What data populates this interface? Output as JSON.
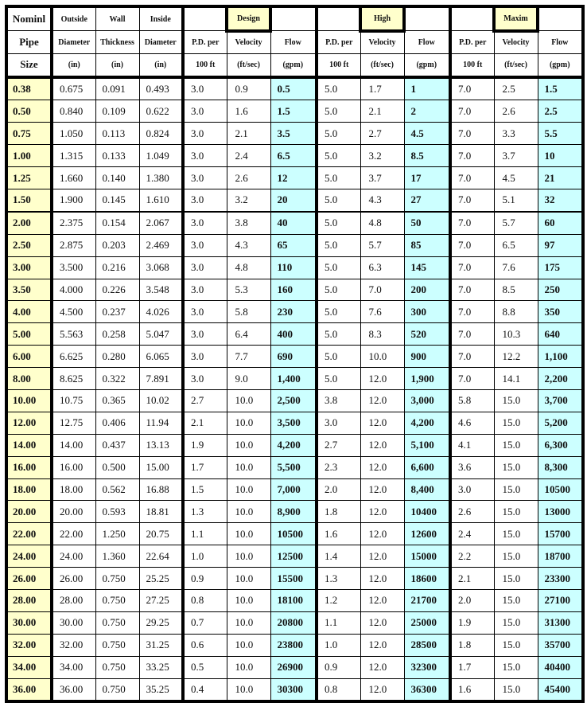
{
  "header": {
    "row1": [
      "Nominl",
      "Outside",
      "Wall",
      "Inside",
      "",
      "Design",
      "",
      "",
      "High",
      "",
      "",
      "Maxim",
      ""
    ],
    "row2": [
      "Pipe",
      "Diameter",
      "Thickness",
      "Diameter",
      "P.D. per",
      "Velocity",
      "Flow",
      "P.D. per",
      "Velocity",
      "Flow",
      "P.D. per",
      "Velocity",
      "Flow"
    ],
    "row3": [
      "Size",
      "(in)",
      "(in)",
      "(in)",
      "100 ft",
      "(ft/sec)",
      "(gpm)",
      "100 ft",
      "(ft/sec)",
      "(gpm)",
      "100 ft",
      "(ft/sec)",
      "(gpm)"
    ]
  },
  "colors": {
    "size_fill": "#ffffcc",
    "flow_fill": "#ccffff",
    "badge_fill": "#ffffcc"
  },
  "rows": [
    [
      "0.38",
      "0.675",
      "0.091",
      "0.493",
      "3.0",
      "0.9",
      "0.5",
      "5.0",
      "1.7",
      "1",
      "7.0",
      "2.5",
      "1.5"
    ],
    [
      "0.50",
      "0.840",
      "0.109",
      "0.622",
      "3.0",
      "1.6",
      "1.5",
      "5.0",
      "2.1",
      "2",
      "7.0",
      "2.6",
      "2.5"
    ],
    [
      "0.75",
      "1.050",
      "0.113",
      "0.824",
      "3.0",
      "2.1",
      "3.5",
      "5.0",
      "2.7",
      "4.5",
      "7.0",
      "3.3",
      "5.5"
    ],
    [
      "1.00",
      "1.315",
      "0.133",
      "1.049",
      "3.0",
      "2.4",
      "6.5",
      "5.0",
      "3.2",
      "8.5",
      "7.0",
      "3.7",
      "10"
    ],
    [
      "1.25",
      "1.660",
      "0.140",
      "1.380",
      "3.0",
      "2.6",
      "12",
      "5.0",
      "3.7",
      "17",
      "7.0",
      "4.5",
      "21"
    ],
    [
      "1.50",
      "1.900",
      "0.145",
      "1.610",
      "3.0",
      "3.2",
      "20",
      "5.0",
      "4.3",
      "27",
      "7.0",
      "5.1",
      "32"
    ],
    [
      "2.00",
      "2.375",
      "0.154",
      "2.067",
      "3.0",
      "3.8",
      "40",
      "5.0",
      "4.8",
      "50",
      "7.0",
      "5.7",
      "60"
    ],
    [
      "2.50",
      "2.875",
      "0.203",
      "2.469",
      "3.0",
      "4.3",
      "65",
      "5.0",
      "5.7",
      "85",
      "7.0",
      "6.5",
      "97"
    ],
    [
      "3.00",
      "3.500",
      "0.216",
      "3.068",
      "3.0",
      "4.8",
      "110",
      "5.0",
      "6.3",
      "145",
      "7.0",
      "7.6",
      "175"
    ],
    [
      "3.50",
      "4.000",
      "0.226",
      "3.548",
      "3.0",
      "5.3",
      "160",
      "5.0",
      "7.0",
      "200",
      "7.0",
      "8.5",
      "250"
    ],
    [
      "4.00",
      "4.500",
      "0.237",
      "4.026",
      "3.0",
      "5.8",
      "230",
      "5.0",
      "7.6",
      "300",
      "7.0",
      "8.8",
      "350"
    ],
    [
      "5.00",
      "5.563",
      "0.258",
      "5.047",
      "3.0",
      "6.4",
      "400",
      "5.0",
      "8.3",
      "520",
      "7.0",
      "10.3",
      "640"
    ],
    [
      "6.00",
      "6.625",
      "0.280",
      "6.065",
      "3.0",
      "7.7",
      "690",
      "5.0",
      "10.0",
      "900",
      "7.0",
      "12.2",
      "1,100"
    ],
    [
      "8.00",
      "8.625",
      "0.322",
      "7.891",
      "3.0",
      "9.0",
      "1,400",
      "5.0",
      "12.0",
      "1,900",
      "7.0",
      "14.1",
      "2,200"
    ],
    [
      "10.00",
      "10.75",
      "0.365",
      "10.02",
      "2.7",
      "10.0",
      "2,500",
      "3.8",
      "12.0",
      "3,000",
      "5.8",
      "15.0",
      "3,700"
    ],
    [
      "12.00",
      "12.75",
      "0.406",
      "11.94",
      "2.1",
      "10.0",
      "3,500",
      "3.0",
      "12.0",
      "4,200",
      "4.6",
      "15.0",
      "5,200"
    ],
    [
      "14.00",
      "14.00",
      "0.437",
      "13.13",
      "1.9",
      "10.0",
      "4,200",
      "2.7",
      "12.0",
      "5,100",
      "4.1",
      "15.0",
      "6,300"
    ],
    [
      "16.00",
      "16.00",
      "0.500",
      "15.00",
      "1.7",
      "10.0",
      "5,500",
      "2.3",
      "12.0",
      "6,600",
      "3.6",
      "15.0",
      "8,300"
    ],
    [
      "18.00",
      "18.00",
      "0.562",
      "16.88",
      "1.5",
      "10.0",
      "7,000",
      "2.0",
      "12.0",
      "8,400",
      "3.0",
      "15.0",
      "10500"
    ],
    [
      "20.00",
      "20.00",
      "0.593",
      "18.81",
      "1.3",
      "10.0",
      "8,900",
      "1.8",
      "12.0",
      "10400",
      "2.6",
      "15.0",
      "13000"
    ],
    [
      "22.00",
      "22.00",
      "1.250",
      "20.75",
      "1.1",
      "10.0",
      "10500",
      "1.6",
      "12.0",
      "12600",
      "2.4",
      "15.0",
      "15700"
    ],
    [
      "24.00",
      "24.00",
      "1.360",
      "22.64",
      "1.0",
      "10.0",
      "12500",
      "1.4",
      "12.0",
      "15000",
      "2.2",
      "15.0",
      "18700"
    ],
    [
      "26.00",
      "26.00",
      "0.750",
      "25.25",
      "0.9",
      "10.0",
      "15500",
      "1.3",
      "12.0",
      "18600",
      "2.1",
      "15.0",
      "23300"
    ],
    [
      "28.00",
      "28.00",
      "0.750",
      "27.25",
      "0.8",
      "10.0",
      "18100",
      "1.2",
      "12.0",
      "21700",
      "2.0",
      "15.0",
      "27100"
    ],
    [
      "30.00",
      "30.00",
      "0.750",
      "29.25",
      "0.7",
      "10.0",
      "20800",
      "1.1",
      "12.0",
      "25000",
      "1.9",
      "15.0",
      "31300"
    ],
    [
      "32.00",
      "32.00",
      "0.750",
      "31.25",
      "0.6",
      "10.0",
      "23800",
      "1.0",
      "12.0",
      "28500",
      "1.8",
      "15.0",
      "35700"
    ],
    [
      "34.00",
      "34.00",
      "0.750",
      "33.25",
      "0.5",
      "10.0",
      "26900",
      "0.9",
      "12.0",
      "32300",
      "1.7",
      "15.0",
      "40400"
    ],
    [
      "36.00",
      "36.00",
      "0.750",
      "35.25",
      "0.4",
      "10.0",
      "30300",
      "0.8",
      "12.0",
      "36300",
      "1.6",
      "15.0",
      "45400"
    ]
  ]
}
